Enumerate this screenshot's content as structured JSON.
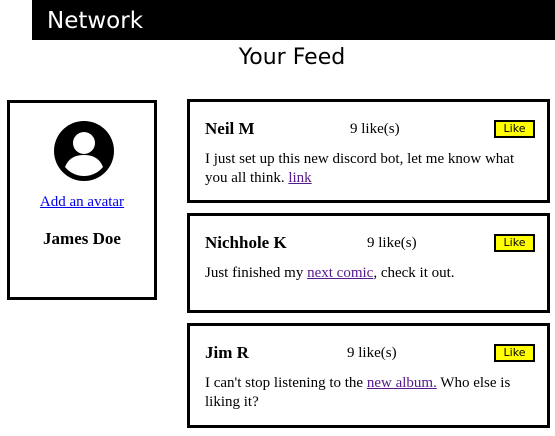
{
  "navbar": {
    "brand": "Network"
  },
  "feed": {
    "title": "Your Feed"
  },
  "profile": {
    "avatar_icon": "user-avatar-icon",
    "add_avatar_label": "Add an avatar",
    "name": "James Doe"
  },
  "posts": [
    {
      "author": "Neil M",
      "likes": "9 like(s)",
      "like_label": "Like",
      "text_before": "I just set up this new discord bot, let me know what you all think. ",
      "link_text": "link",
      "text_after": ""
    },
    {
      "author": "Nichhole K",
      "likes": "9 like(s)",
      "like_label": "Like",
      "text_before": "Just finished my ",
      "link_text": "next comic",
      "text_after": ", check it out."
    },
    {
      "author": "Jim R",
      "likes": "9 like(s)",
      "like_label": "Like",
      "text_before": "I can't stop listening to the ",
      "link_text": "new album.",
      "text_after": " Who else is liking it?"
    }
  ],
  "colors": {
    "navbar_bg": "#000000",
    "like_button_bg": "#ffff00",
    "link_unvisited": "#0000ee",
    "link_visited": "#551a8b"
  }
}
